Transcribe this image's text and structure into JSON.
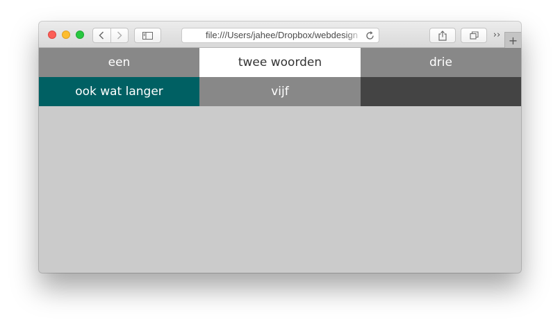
{
  "browser": {
    "address_url": "file:///Users/jahee/Dropbox/webdesign",
    "overflow_label": "››",
    "new_tab_label": "+"
  },
  "menu": {
    "items": [
      {
        "label": "een",
        "state": "default",
        "color": "#888888"
      },
      {
        "label": "twee woorden",
        "state": "active",
        "color": "#ffffff"
      },
      {
        "label": "drie",
        "state": "default",
        "color": "#888888"
      },
      {
        "label": "ook wat langer",
        "state": "hover",
        "color": "#006063"
      },
      {
        "label": "vijf",
        "state": "default",
        "color": "#888888"
      },
      {
        "label": "",
        "state": "empty",
        "color": "#444444"
      }
    ]
  },
  "page": {
    "background": "#cbcbcb"
  }
}
